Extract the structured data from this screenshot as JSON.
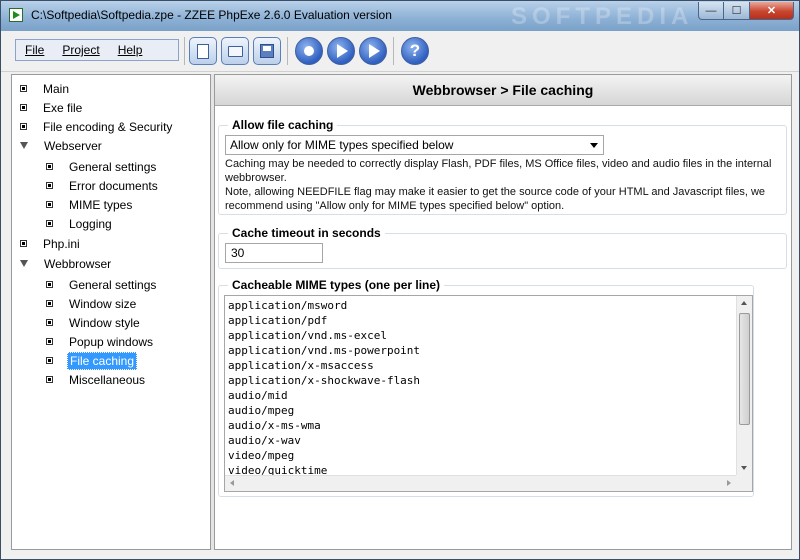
{
  "window": {
    "title": "C:\\Softpedia\\Softpedia.zpe - ZZEE PhpExe 2.6.0 Evaluation version",
    "watermark": "SOFTPEDIA",
    "controls": {
      "minimize": "—",
      "maximize": "☐",
      "close": "✕"
    }
  },
  "menu": {
    "file": "File",
    "project": "Project",
    "help": "Help"
  },
  "toolbar": {
    "buttons": [
      "new-document-icon",
      "open-folder-icon",
      "save-disk-icon",
      "stop-icon",
      "run-icon",
      "play-icon",
      "help-icon"
    ],
    "help_glyph": "?"
  },
  "tree": {
    "items": [
      {
        "label": "Main"
      },
      {
        "label": "Exe file"
      },
      {
        "label": "File encoding & Security"
      },
      {
        "label": "Webserver"
      },
      {
        "label": "General settings"
      },
      {
        "label": "Error documents"
      },
      {
        "label": "MIME types"
      },
      {
        "label": "Logging"
      },
      {
        "label": "Php.ini"
      },
      {
        "label": "Webbrowser"
      },
      {
        "label": "General settings"
      },
      {
        "label": "Window size"
      },
      {
        "label": "Window style"
      },
      {
        "label": "Popup windows"
      },
      {
        "label": "File caching"
      },
      {
        "label": "Miscellaneous"
      }
    ],
    "selected": "File caching"
  },
  "page": {
    "header": "Webbrowser > File caching",
    "caching": {
      "title": "Allow file caching",
      "selected_option": "Allow only for MIME types specified below",
      "info_lines": [
        "Caching may be needed to correctly display Flash, PDF files, MS Office files, video and audio files in the internal",
        "webbrowser.",
        "Note, allowing NEEDFILE flag may make it easier to get the source code of your HTML and Javascript files, we",
        "recommend using \"Allow only for MIME types specified below\" option."
      ]
    },
    "timeout": {
      "title": "Cache timeout in seconds",
      "value": "30"
    },
    "mime": {
      "title": "Cacheable MIME types (one per line)",
      "lines": [
        "application/msword",
        "application/pdf",
        "application/vnd.ms-excel",
        "application/vnd.ms-powerpoint",
        "application/x-msaccess",
        "application/x-shockwave-flash",
        "audio/mid",
        "audio/mpeg",
        "audio/x-ms-wma",
        "audio/x-wav",
        "video/mpeg",
        "video/quicktime"
      ]
    }
  },
  "colors": {
    "selection": "#3399ff",
    "titlebar": "#9dbbdc",
    "toolbar_button": "#2f5fc0"
  }
}
